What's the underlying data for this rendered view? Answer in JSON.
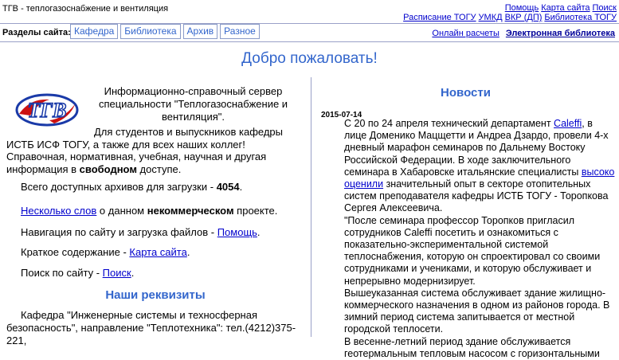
{
  "header": {
    "site_title": "ТГВ - теплогазоснабжение и вентиляция",
    "links_row1": [
      "Помощь",
      "Карта сайта",
      "Поиск"
    ],
    "links_row2": [
      "Расписание ТОГУ",
      "УМКД",
      "ВКР (ДП)",
      "Библиотека ТОГУ"
    ],
    "sections_label": "Разделы сайта:",
    "tabs": [
      "Кафедра",
      "Библиотека",
      "Архив",
      "Разное"
    ],
    "right_links": [
      "Онлайн расчеты",
      "Электронная библиотека"
    ]
  },
  "welcome": "Добро пожаловать!",
  "left": {
    "intro": "Информационно-справочный сервер специальности \"Теплогазоснабжение и вентиляция\".",
    "students_pre": "Для студентов и выпускников кафедры ИСТБ ИСФ ТОГУ, а также для всех наших коллег! Справочная, нормативная, учебная, научная и другая информация в ",
    "students_bold": "свободном",
    "students_post": " доступе.",
    "archives_text": "Всего доступных архивов для загрузки - ",
    "archives_count": "4054",
    "archives_end": ".",
    "words_link": "Несколько слов",
    "words_mid": " о данном ",
    "words_bold": "некоммерческом",
    "words_end": " проекте.",
    "nav_text": "Навигация по сайту и загрузка файлов - ",
    "nav_link": "Помощь",
    "summary_text": "Краткое содержание - ",
    "summary_link": "Карта сайта",
    "search_text": "Поиск по сайту - ",
    "search_link": "Поиск",
    "period": ".",
    "requisites_title": "Наши реквизиты",
    "requisites_text": "Кафедра \"Инженерные системы и техносферная безопасность\", направление \"Теплотехника\": тел.(4212)375-221,"
  },
  "news": {
    "title": "Новости",
    "date": "2015-07-14",
    "p1_a": "С 20 по 24 апреля технический департамент ",
    "p1_link": "Caleffi",
    "p1_b": ", в лице Доменико Мацщетти и Андреа Дзардо, провели 4-х дневный марафон семинаров по Дальнему Востоку Российской Федерации. В ходе заключительного семинара в Хабаровске итальянские специалисты ",
    "p1_link2": "высоко оценили",
    "p1_c": " значительный опыт в секторе отопительных систем преподавателя кафедры ИСТБ ТОГУ - Торопкова Сергея Алексеевича.",
    "p2": "\"После семинара профессор Торопков пригласил сотрудников Caleffi посетить и ознакомиться с показательно-экспериментальной системой теплоснабжения, которую он спроектировал со своими сотрудниками и учениками, и которую обслуживает и непрерывно модернизирует.",
    "p3": "Вышеуказанная система обслуживает здание жилищно-коммерческого назначения в одном из районов города. В зимний период система запитывается от местной городской теплосети.",
    "p4": "В весенне-летний период здание обслуживается геотермальным тепловым насосом с горизонтальными"
  },
  "logo_text": "ТГВ"
}
